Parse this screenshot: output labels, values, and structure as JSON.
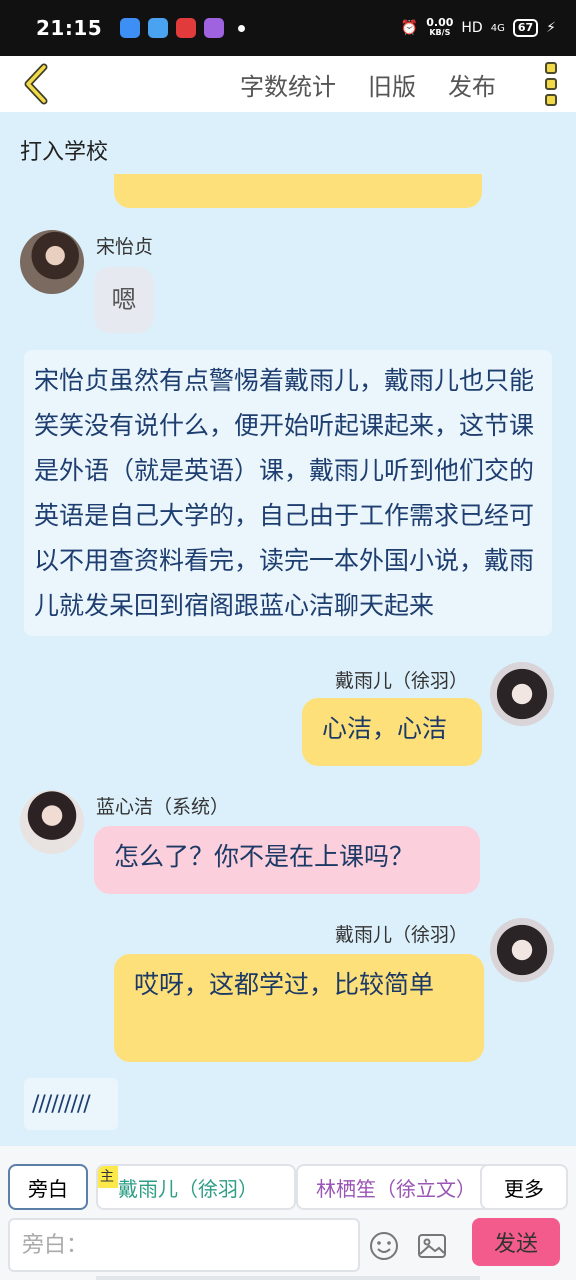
{
  "status_bar": {
    "time": "21:15",
    "speed_value": "0.00",
    "speed_unit": "KB/S",
    "network": "HD",
    "signal": "4G",
    "battery": "67"
  },
  "nav": {
    "links": [
      "字数统计",
      "旧版",
      "发布"
    ],
    "icons": {
      "back": "chevron-left-icon",
      "more": "more-menu-icon"
    }
  },
  "chat": {
    "title": "打入学校",
    "messages": [
      {
        "name": "宋怡贞",
        "text": "嗯"
      },
      {
        "text": "宋怡贞虽然有点警惕着戴雨儿，戴雨儿也只能笑笑没有说什么，便开始听起课起来，这节课是外语（就是英语）课，戴雨儿听到他们交的英语是自己大学的，自己由于工作需求已经可以不用查资料看完，读完一本外国小说，戴雨儿就发呆回到宿阁跟蓝心洁聊天起来"
      },
      {
        "name": "戴雨儿（徐羽）",
        "text": "心洁，心洁"
      },
      {
        "name": "蓝心洁（系统）",
        "text": "怎么了？你不是在上课吗？"
      },
      {
        "name": "戴雨儿（徐羽）",
        "text": "哎呀，这都学过，比较简单"
      },
      {
        "text": "/////////"
      }
    ]
  },
  "bottom": {
    "tabs": [
      "旁白",
      "戴雨儿（徐羽）",
      "林栖笙（徐立文）",
      "更多"
    ],
    "main_badge": "主",
    "input_placeholder": "旁白：",
    "send_label": "发送",
    "icons": {
      "emoji": "emoji-icon",
      "image": "image-icon"
    }
  },
  "colors": {
    "chat_bg": "#dcf0fb",
    "yellow_bubble": "#fde07a",
    "pink_bubble": "#fbcfdb",
    "send_button": "#f35b8c"
  }
}
